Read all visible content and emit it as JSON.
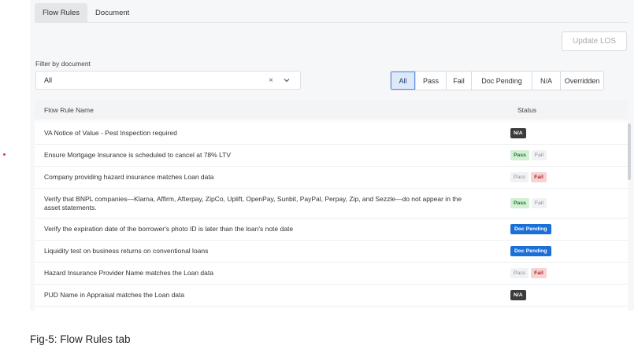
{
  "tabs": [
    {
      "label": "Flow Rules",
      "active": true
    },
    {
      "label": "Document",
      "active": false
    }
  ],
  "update_button": {
    "label": "Update LOS"
  },
  "filter": {
    "label": "Filter by document",
    "value": "All",
    "clear_glyph": "×",
    "chevron_icon": "chevron-down-icon"
  },
  "status_filters": [
    {
      "label": "All",
      "active": true
    },
    {
      "label": "Pass",
      "active": false
    },
    {
      "label": "Fail",
      "active": false
    },
    {
      "label": "Doc Pending",
      "active": false
    },
    {
      "label": "N/A",
      "active": false
    },
    {
      "label": "Overridden",
      "active": false
    }
  ],
  "table": {
    "columns": [
      "Flow Rule Name",
      "Status"
    ],
    "rows": [
      {
        "name": "VA Notice of Value - Pest Inspection required",
        "status": "na"
      },
      {
        "name": "Ensure Mortgage Insurance is scheduled to cancel at 78% LTV",
        "status": "pass"
      },
      {
        "name": "Company providing hazard insurance matches Loan data",
        "status": "fail"
      },
      {
        "name": "Verify that BNPL companies—Klarna, Affirm, Afterpay, ZipCo, Uplift, OpenPay, Sunbit, PayPal, Perpay, Zip, and Sezzle—do not appear in the asset statements.",
        "status": "pass"
      },
      {
        "name": "Verify the expiration date of the borrower's photo ID is later than the loan's note date",
        "status": "doc_pending"
      },
      {
        "name": "Liquidity test on business returns on conventional loans",
        "status": "doc_pending"
      },
      {
        "name": "Hazard Insurance Provider Name matches the Loan data",
        "status": "fail"
      },
      {
        "name": "PUD Name in Appraisal matches the Loan data",
        "status": "na"
      }
    ]
  },
  "badges": {
    "pass": "Pass",
    "fail": "Fail",
    "na": "N/A",
    "doc_pending": "Doc Pending"
  },
  "caption": "Fig-5: Flow Rules tab",
  "colors": {
    "accent": "#1a6fd8",
    "pass": "#23742e",
    "fail": "#b0262b",
    "na": "#3b3b3b"
  }
}
